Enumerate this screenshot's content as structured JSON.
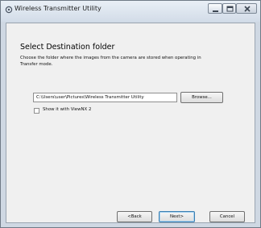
{
  "window": {
    "title": "Wireless Transmitter Utility",
    "controls": [
      "minimize-icon",
      "maximize-icon",
      "close-icon"
    ]
  },
  "page": {
    "heading": "Select Destination folder",
    "description": "Choose the folder where the images from the camera are stored when operating in Transfer mode."
  },
  "folder": {
    "path": "C:\\Users\\user\\Pictures\\Wireless Transmitter Utility",
    "browse_label": "Browse..."
  },
  "options": {
    "show_with_viewnx_label": "Show it with ViewNX 2",
    "show_with_viewnx_checked": false
  },
  "nav": {
    "back_label": "<Back",
    "next_label": "Next>",
    "cancel_label": "Cancel"
  }
}
